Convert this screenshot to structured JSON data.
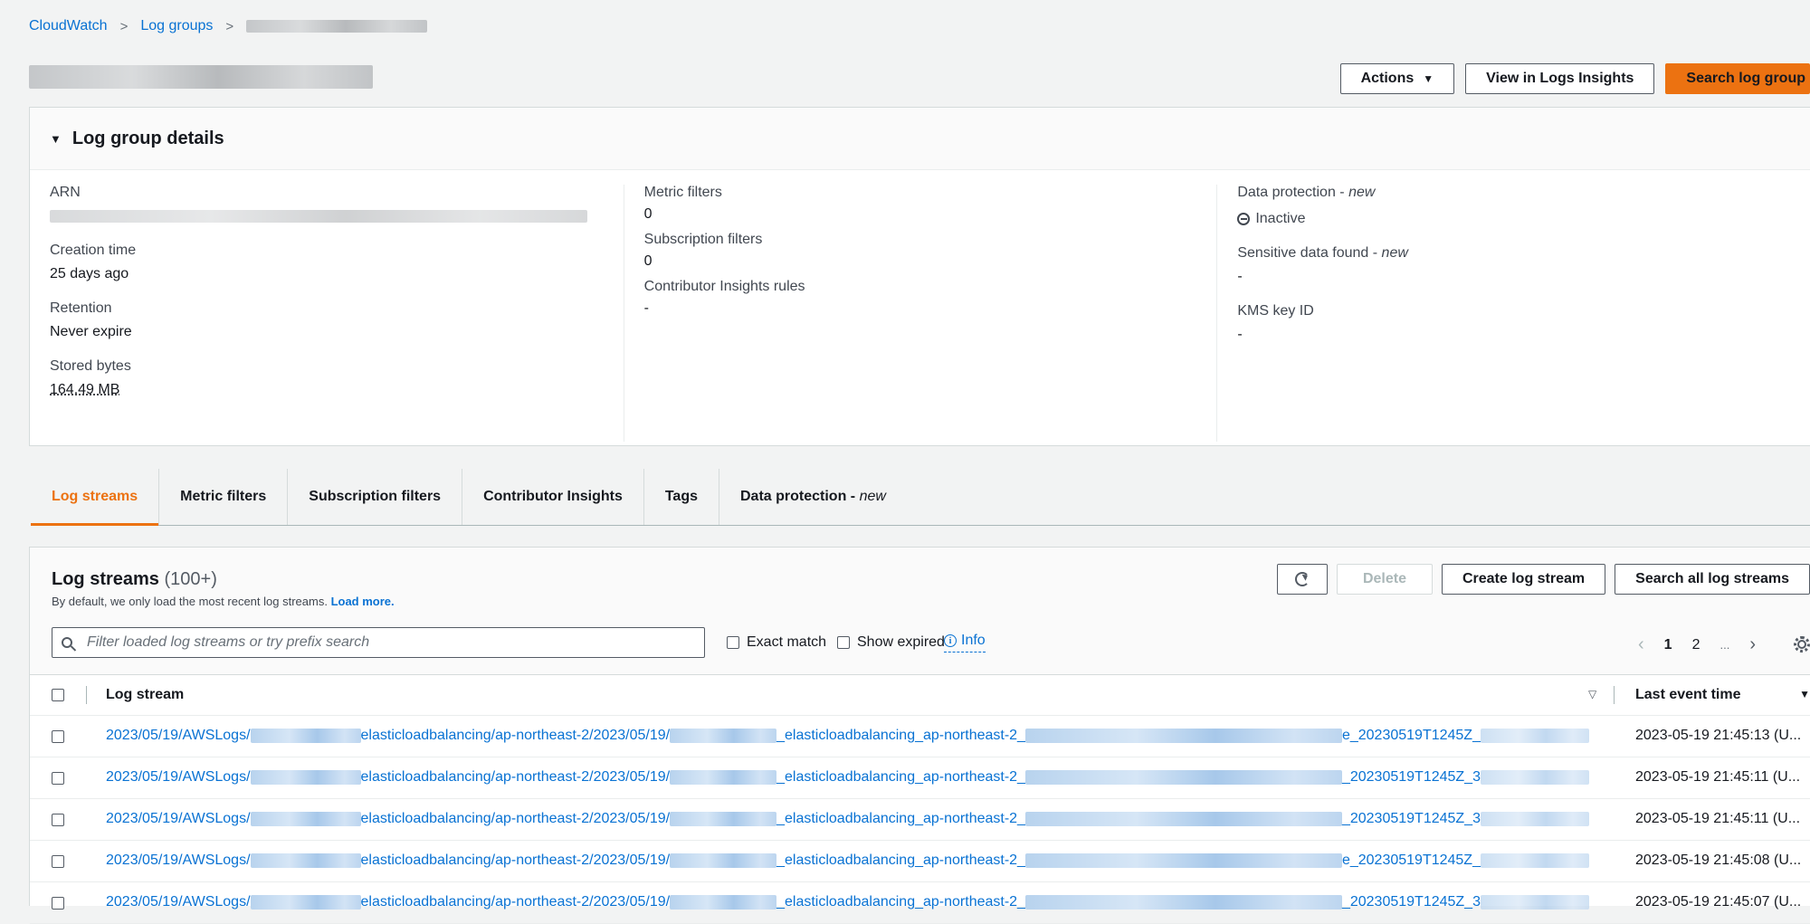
{
  "breadcrumb": {
    "items": [
      "CloudWatch",
      "Log groups"
    ]
  },
  "header": {
    "actions_label": "Actions",
    "insights_label": "View in Logs Insights",
    "search_label": "Search log group"
  },
  "details": {
    "title": "Log group details",
    "arn_label": "ARN",
    "creation_label": "Creation time",
    "creation_value": "25 days ago",
    "retention_label": "Retention",
    "retention_value": "Never expire",
    "stored_label": "Stored bytes",
    "stored_value": "164.49 MB",
    "metric_filters_label": "Metric filters",
    "metric_filters_value": "0",
    "subscription_label": "Subscription filters",
    "subscription_value": "0",
    "contributor_label": "Contributor Insights rules",
    "contributor_value": "-",
    "data_protection_label": "Data protection - ",
    "data_protection_new": "new",
    "data_protection_value": "Inactive",
    "sensitive_label": "Sensitive data found - ",
    "sensitive_new": "new",
    "sensitive_value": "-",
    "kms_label": "KMS key ID",
    "kms_value": "-"
  },
  "tabs": [
    {
      "label": "Log streams",
      "active": true
    },
    {
      "label": "Metric filters"
    },
    {
      "label": "Subscription filters"
    },
    {
      "label": "Contributor Insights"
    },
    {
      "label": "Tags"
    },
    {
      "label": "Data protection - ",
      "suffix": "new"
    }
  ],
  "streams": {
    "title": "Log streams",
    "count": "(100+)",
    "description": "By default, we only load the most recent log streams.",
    "load_more": "Load more.",
    "delete_label": "Delete",
    "create_label": "Create log stream",
    "search_all_label": "Search all log streams",
    "search_placeholder": "Filter loaded log streams or try prefix search",
    "exact_match": "Exact match",
    "show_expired": "Show expired",
    "info": "Info",
    "pages": [
      "1",
      "2",
      "..."
    ],
    "col_stream": "Log stream",
    "col_time": "Last event time",
    "rows": [
      {
        "p1": "2023/05/19/AWSLogs/",
        "p2": "elasticloadbalancing/ap-northeast-2/2023/05/19/",
        "p3": "_elasticloadbalancing_ap-northeast-2_",
        "p4": "e_20230519T1245Z_",
        "time": "2023-05-19 21:45:13 (U..."
      },
      {
        "p1": "2023/05/19/AWSLogs/",
        "p2": "elasticloadbalancing/ap-northeast-2/2023/05/19/",
        "p3": "_elasticloadbalancing_ap-northeast-2_",
        "p4": "_20230519T1245Z_3",
        "time": "2023-05-19 21:45:11 (U..."
      },
      {
        "p1": "2023/05/19/AWSLogs/",
        "p2": "elasticloadbalancing/ap-northeast-2/2023/05/19/",
        "p3": "_elasticloadbalancing_ap-northeast-2_",
        "p4": "_20230519T1245Z_3",
        "time": "2023-05-19 21:45:11 (U..."
      },
      {
        "p1": "2023/05/19/AWSLogs/",
        "p2": "elasticloadbalancing/ap-northeast-2/2023/05/19/",
        "p3": "_elasticloadbalancing_ap-northeast-2_",
        "p4": "e_20230519T1245Z_",
        "time": "2023-05-19 21:45:08 (U..."
      },
      {
        "p1": "2023/05/19/AWSLogs/",
        "p2": "elasticloadbalancing/ap-northeast-2/2023/05/19/",
        "p3": "_elasticloadbalancing_ap-northeast-2_",
        "p4": "_20230519T1245Z_3",
        "time": "2023-05-19 21:45:07 (U..."
      }
    ]
  }
}
